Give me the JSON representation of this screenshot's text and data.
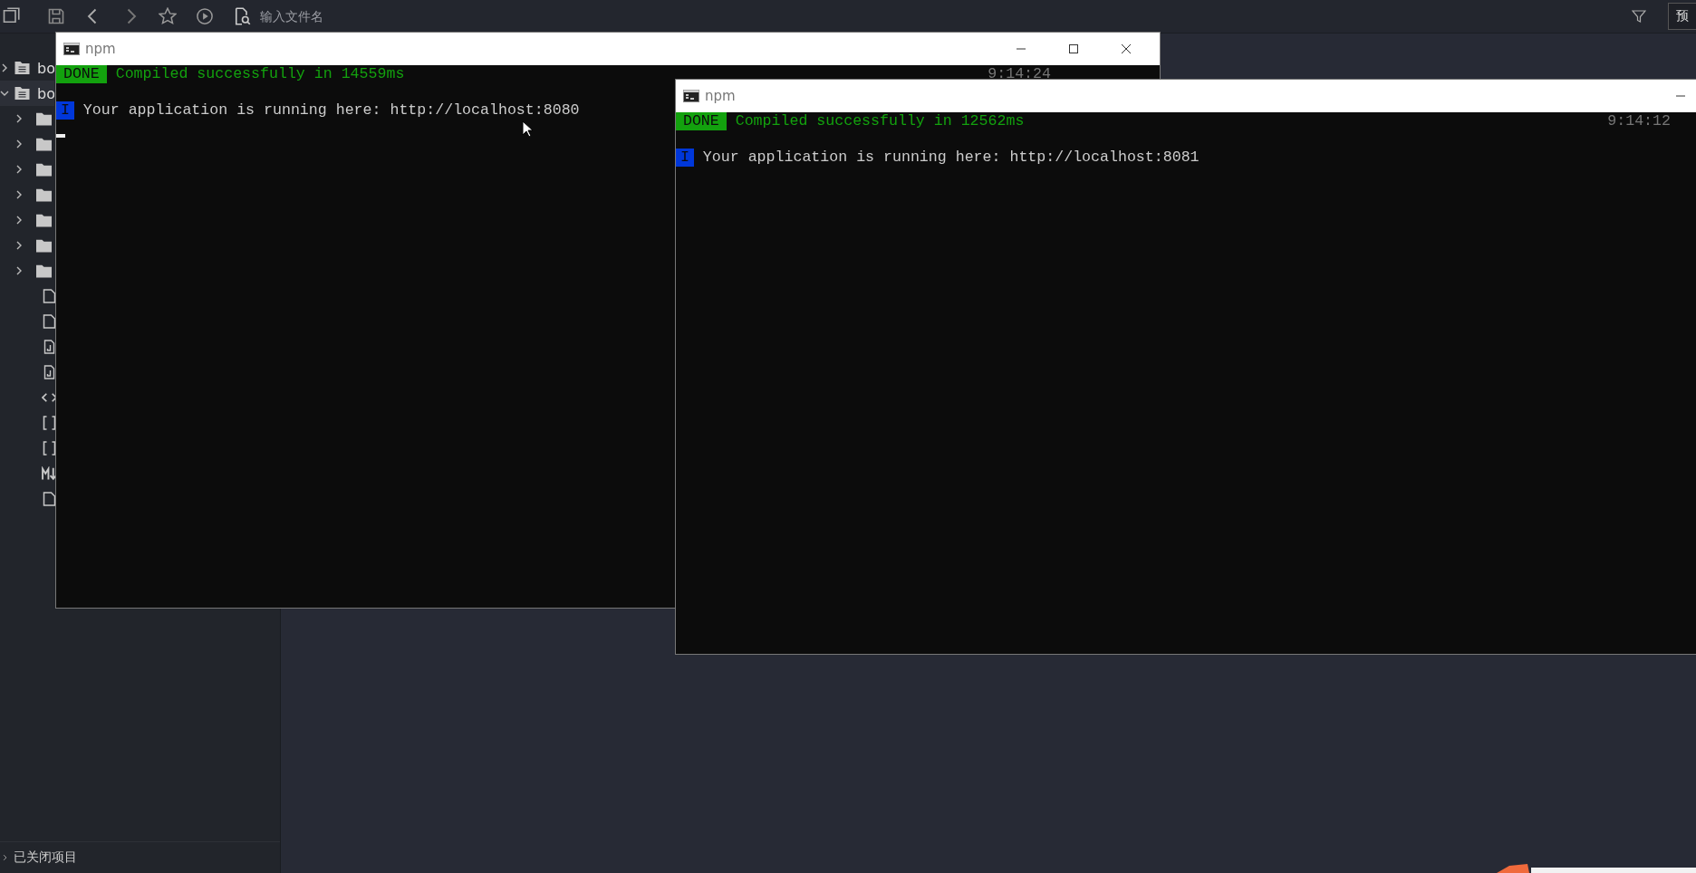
{
  "toolbar": {
    "search": {
      "placeholder": "输入文件名"
    },
    "preview_button": "预"
  },
  "sidebar": {
    "projects": [
      {
        "label": "bo",
        "expanded": false,
        "selected": false
      },
      {
        "label": "bo",
        "expanded": true,
        "selected": true,
        "children": [
          {
            "kind": "folder",
            "expanded": false
          },
          {
            "kind": "folder",
            "expanded": false
          },
          {
            "kind": "folder",
            "expanded": false
          },
          {
            "kind": "folder",
            "expanded": false
          },
          {
            "kind": "folder",
            "expanded": false
          },
          {
            "kind": "folder",
            "expanded": false
          },
          {
            "kind": "folder",
            "expanded": false
          },
          {
            "kind": "file"
          },
          {
            "kind": "file"
          },
          {
            "kind": "java"
          },
          {
            "kind": "java"
          },
          {
            "kind": "code"
          },
          {
            "kind": "brackets"
          },
          {
            "kind": "brackets"
          },
          {
            "kind": "markdown"
          },
          {
            "kind": "file"
          }
        ]
      }
    ],
    "footer": "已关闭项目"
  },
  "windows": [
    {
      "title": "npm",
      "controls": [
        {
          "kind": "minimize"
        },
        {
          "kind": "maximize"
        },
        {
          "kind": "close"
        }
      ],
      "cursor": true,
      "pointer": true,
      "lines": [
        {
          "badge": "DONE",
          "kind": "done",
          "text": "Compiled successfully in 14559ms",
          "time": "9:14:24"
        },
        {
          "badge": "I",
          "kind": "info",
          "text": "Your application is running here: http://localhost:8080"
        }
      ]
    },
    {
      "title": "npm",
      "controls": [
        {
          "kind": "minimize"
        }
      ],
      "cursor": false,
      "pointer": false,
      "lines": [
        {
          "badge": "DONE",
          "kind": "done",
          "text": "Compiled successfully in 12562ms",
          "time": "9:14:12"
        },
        {
          "badge": "I",
          "kind": "info",
          "text": "Your application is running here: http://localhost:8081"
        }
      ]
    }
  ]
}
